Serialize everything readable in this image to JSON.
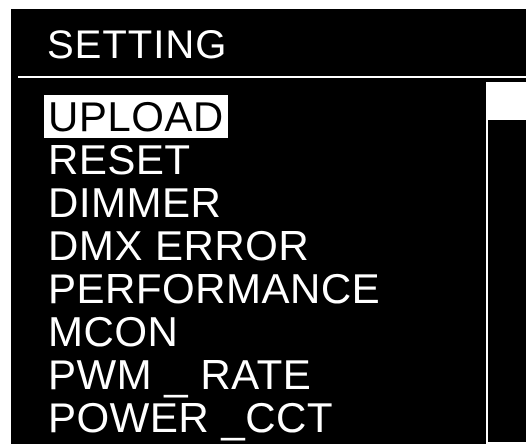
{
  "header": {
    "title": "SETTING"
  },
  "menu": {
    "selected_index": 0,
    "items": [
      {
        "label": "UPLOAD"
      },
      {
        "label": "RESET"
      },
      {
        "label": "DIMMER"
      },
      {
        "label": "DMX ERROR"
      },
      {
        "label": "PERFORMANCE"
      },
      {
        "label": "MCON"
      },
      {
        "label": "PWM _ RATE"
      },
      {
        "label": "POWER _CCT"
      }
    ]
  },
  "scrollbar": {
    "position_fraction": 0.0
  },
  "colors": {
    "background": "#000000",
    "foreground": "#ffffff",
    "highlight_text": "#000000"
  }
}
